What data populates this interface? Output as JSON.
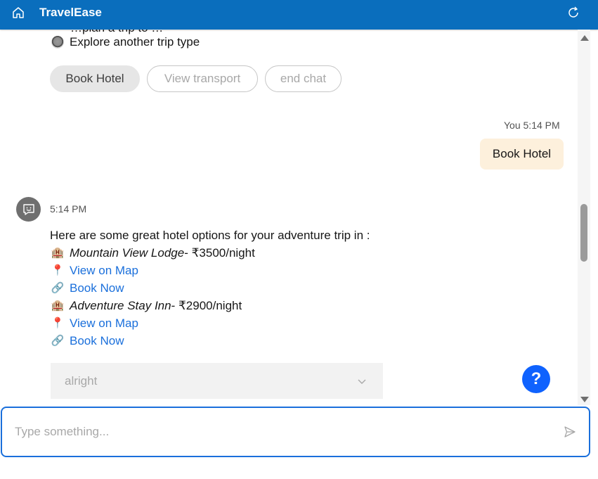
{
  "header": {
    "title": "TravelEase"
  },
  "chat": {
    "partial_line": "…plan a trip to …",
    "explore_option": "Explore another trip type",
    "chips": [
      {
        "label": "Book Hotel"
      },
      {
        "label": "View transport"
      },
      {
        "label": "end chat"
      }
    ],
    "user_message": {
      "meta": "You 5:14 PM",
      "text": "Book Hotel"
    },
    "bot_message": {
      "time": "5:14 PM",
      "intro": "Here are some great hotel options for your adventure trip in :",
      "hotels": [
        {
          "name": "Mountain View Lodge",
          "price": " - ₹3500/night",
          "map_link": "View on Map",
          "book_link": "Book Now"
        },
        {
          "name": "Adventure Stay Inn",
          "price": " - ₹2900/night",
          "map_link": "View on Map",
          "book_link": "Book Now"
        }
      ]
    },
    "dropdown": {
      "selected": "alright"
    },
    "help_label": "?"
  },
  "composer": {
    "placeholder": "Type something..."
  },
  "icons": {
    "home": "home-icon",
    "refresh": "refresh-icon",
    "avatar": "chat-bot-icon",
    "hotel": "hotel-icon",
    "pin": "map-pin-icon",
    "link": "link-icon",
    "chevron": "chevron-down-icon",
    "send": "send-icon"
  },
  "colors": {
    "header": "#0a6ebd",
    "accent": "#0f62fe",
    "user_bubble": "#fdf0dc",
    "link": "#1a6fdb"
  }
}
